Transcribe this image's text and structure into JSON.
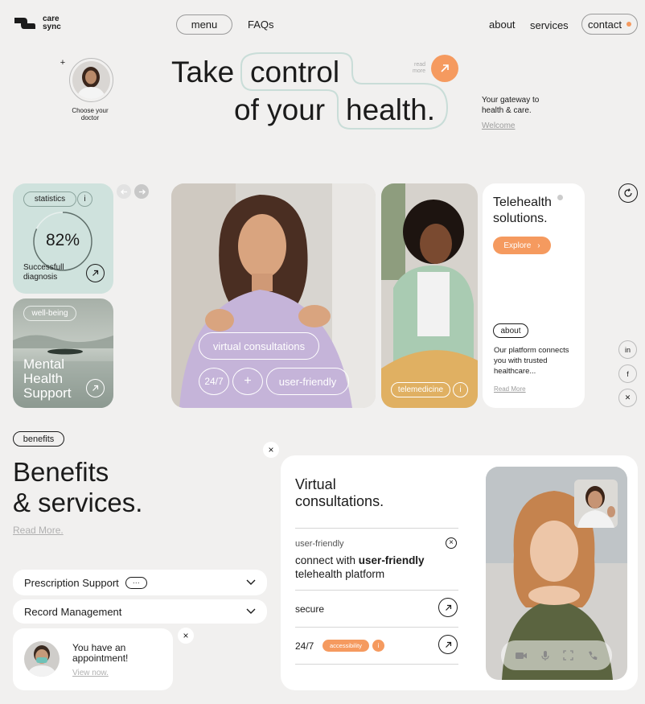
{
  "brand": {
    "line1": "care",
    "line2": "sync"
  },
  "nav": {
    "menu": "menu",
    "faqs": "FAQs",
    "about": "about",
    "services": "services",
    "contact": "contact"
  },
  "doctor_picker": {
    "label": "Choose your doctor",
    "add": "+"
  },
  "hero": {
    "word_take": "Take",
    "word_control": "control",
    "word_of_your": "of your",
    "word_health": "health.",
    "read_more": "read more",
    "gateway": "Your gateway to health & care.",
    "welcome": "Welcome"
  },
  "stats_card": {
    "badge": "statistics",
    "info": "i",
    "value": "82%",
    "label": "Successfull diagnosis",
    "progress": 0.82
  },
  "wellbeing_card": {
    "badge": "well-being",
    "title": "Mental Health Support"
  },
  "main_photo": {
    "tag_virtual": "virtual consultations",
    "tag_247": "24/7",
    "tag_plus": "+",
    "tag_friendly": "user-friendly"
  },
  "second_photo": {
    "tag": "telemedicine",
    "info": "i"
  },
  "telehealth": {
    "title": "Telehealth solutions.",
    "explore": "Explore",
    "about_badge": "about",
    "description": "Our platform connects you with trusted healthcare...",
    "read_more": "Read More"
  },
  "social": {
    "linkedin": "in",
    "facebook": "f",
    "x": "✕"
  },
  "benefits": {
    "badge": "benefits",
    "title_line1": "Benefits",
    "title_line2": "& services.",
    "read_more": "Read More.",
    "close": "×"
  },
  "accordion": [
    {
      "label": "Prescription Support",
      "extra": "···"
    },
    {
      "label": "Record Management",
      "extra": ""
    }
  ],
  "appointment": {
    "text": "You have an appointment!",
    "link": "View now.",
    "close": "×"
  },
  "consult": {
    "title_line1": "Virtual",
    "title_line2": "consultations.",
    "feature_small": "user-friendly",
    "feature_pre": "connect with ",
    "feature_bold": "user-friendly",
    "feature_post": "telehealth platform",
    "close": "×",
    "rows": [
      {
        "label": "secure"
      },
      {
        "label": "24/7",
        "badge": "accessibility",
        "info": "i"
      }
    ]
  },
  "colors": {
    "accent": "#f59a5f",
    "mint": "#cfe2dd",
    "bg": "#f1f0ef"
  }
}
